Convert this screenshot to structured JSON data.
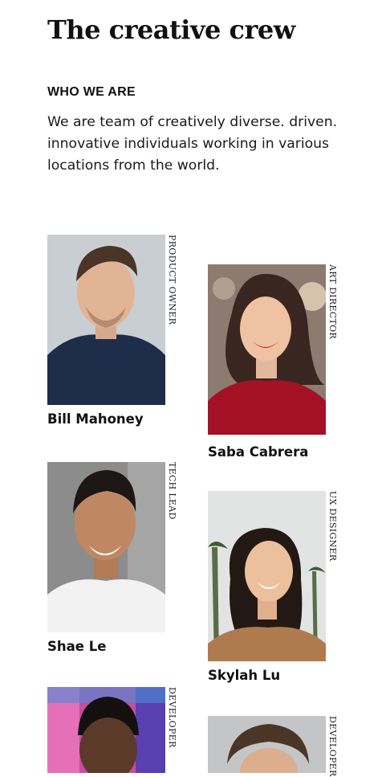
{
  "page": {
    "title": "The creative crew",
    "eyebrow": "WHO WE ARE",
    "intro": "We are team of creatively diverse. driven. innovative individuals working in various locations from the world."
  },
  "team": [
    {
      "name": "Bill Mahoney",
      "role": "PRODUCT OWNER"
    },
    {
      "name": "Saba Cabrera",
      "role": "ART DIRECTOR"
    },
    {
      "name": "Shae Le",
      "role": "TECH LEAD"
    },
    {
      "name": "Skylah Lu",
      "role": "UX DESIGNER"
    },
    {
      "name": "",
      "role": "DEVELOPER"
    },
    {
      "name": "",
      "role": "DEVELOPER"
    }
  ]
}
